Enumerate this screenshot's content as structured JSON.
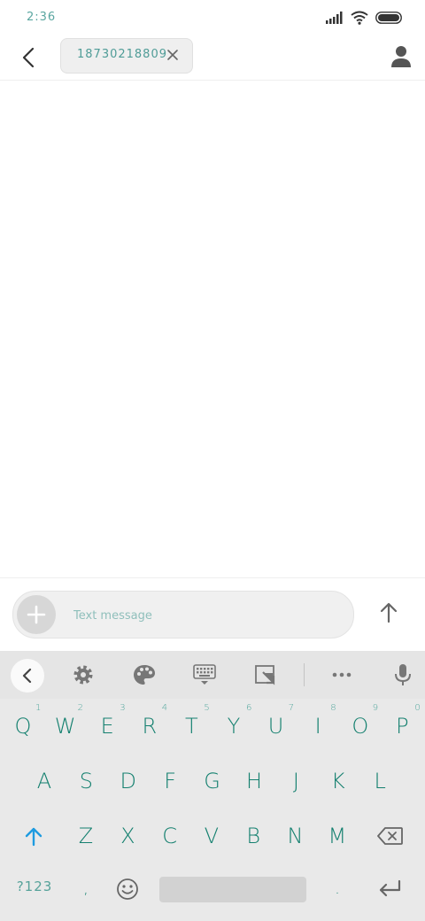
{
  "status": {
    "time": "2:36"
  },
  "header": {
    "recipient": "18730218809"
  },
  "compose": {
    "placeholder": "Text message"
  },
  "keyboard": {
    "row1": [
      {
        "letter": "Q",
        "hint": "1"
      },
      {
        "letter": "W",
        "hint": "2"
      },
      {
        "letter": "E",
        "hint": "3"
      },
      {
        "letter": "R",
        "hint": "4"
      },
      {
        "letter": "T",
        "hint": "5"
      },
      {
        "letter": "Y",
        "hint": "6"
      },
      {
        "letter": "U",
        "hint": "7"
      },
      {
        "letter": "I",
        "hint": "8"
      },
      {
        "letter": "O",
        "hint": "9"
      },
      {
        "letter": "P",
        "hint": "0"
      }
    ],
    "row2": [
      "A",
      "S",
      "D",
      "F",
      "G",
      "H",
      "J",
      "K",
      "L"
    ],
    "row3": [
      "Z",
      "X",
      "C",
      "V",
      "B",
      "N",
      "M"
    ],
    "symbols_label": "?123",
    "comma": ",",
    "period": "."
  },
  "colors": {
    "accent": "#1e9be0",
    "key_text": "#14806f",
    "status_text": "#5aa6a0"
  }
}
